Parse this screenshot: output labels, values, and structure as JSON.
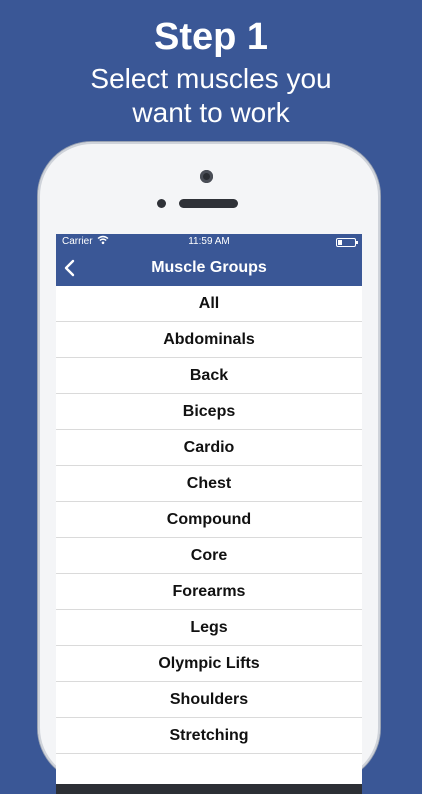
{
  "promo": {
    "step": "Step 1",
    "subtitle_line1": "Select muscles you",
    "subtitle_line2": "want to work"
  },
  "status_bar": {
    "carrier": "Carrier",
    "time": "11:59 AM"
  },
  "nav": {
    "title": "Muscle Groups",
    "back_icon": "chevron-left-icon"
  },
  "muscle_groups": [
    "All",
    "Abdominals",
    "Back",
    "Biceps",
    "Cardio",
    "Chest",
    "Compound",
    "Core",
    "Forearms",
    "Legs",
    "Olympic Lifts",
    "Shoulders",
    "Stretching"
  ],
  "colors": {
    "background": "#3a5796",
    "nav_bar": "#3a5796",
    "list_text": "#111111"
  }
}
